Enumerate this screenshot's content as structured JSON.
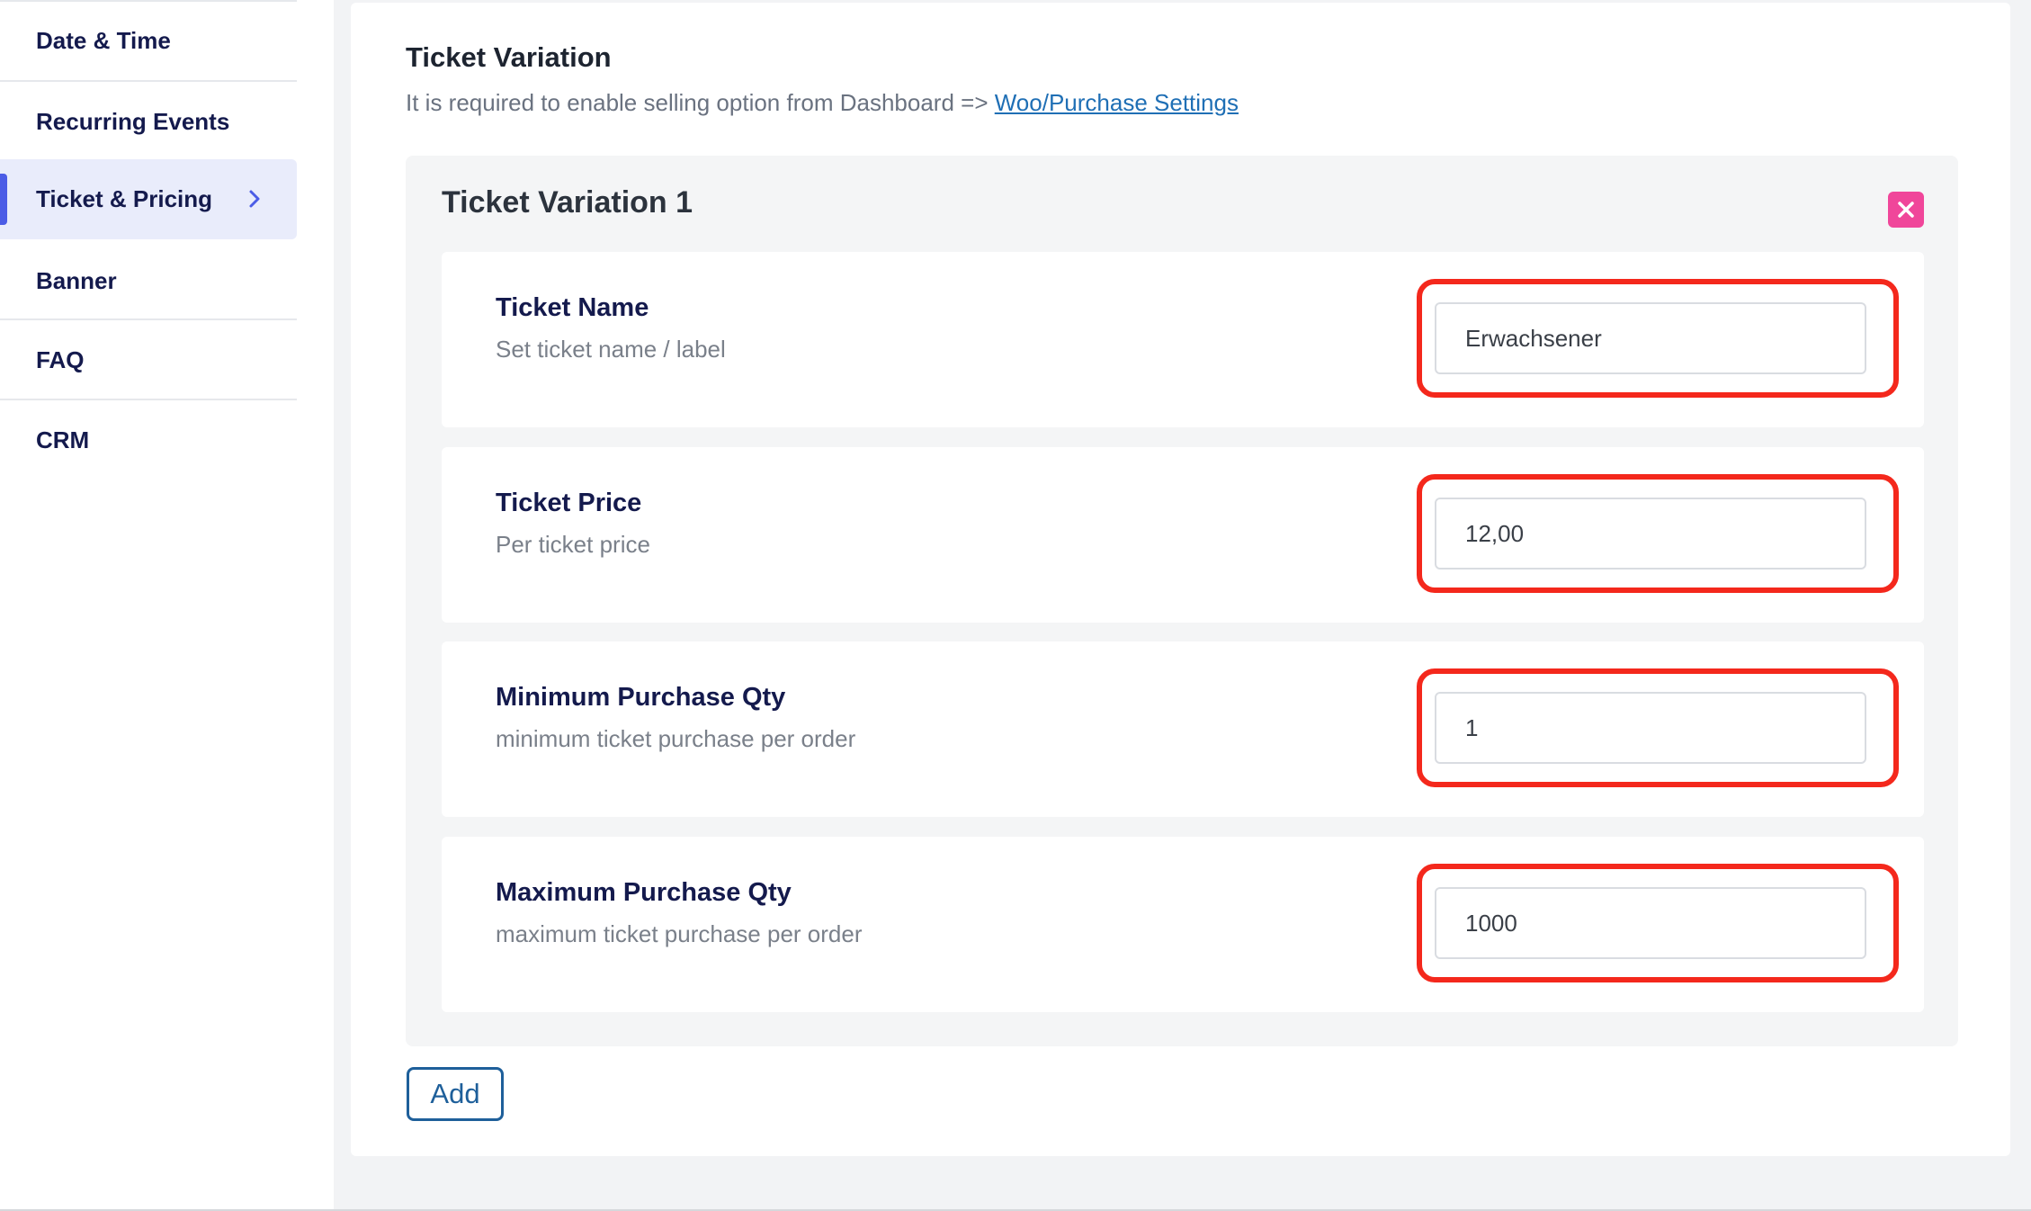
{
  "sidebar": {
    "items": [
      {
        "label": "Date & Time"
      },
      {
        "label": "Recurring Events"
      },
      {
        "label": "Ticket & Pricing"
      },
      {
        "label": "Banner"
      },
      {
        "label": "FAQ"
      },
      {
        "label": "CRM"
      }
    ],
    "active_index": 2
  },
  "section": {
    "title": "Ticket Variation",
    "note": "It is required to enable selling option from Dashboard => ",
    "link_label": "Woo/Purchase Settings"
  },
  "variation": {
    "title": "Ticket Variation 1",
    "fields": [
      {
        "label": "Ticket Name",
        "description": "Set ticket name / label",
        "value": "Erwachsener"
      },
      {
        "label": "Ticket Price",
        "description": "Per ticket price",
        "value": "12,00"
      },
      {
        "label": "Minimum Purchase Qty",
        "description": "minimum ticket purchase per order",
        "value": "1"
      },
      {
        "label": "Maximum Purchase Qty",
        "description": "maximum ticket purchase per order",
        "value": "1000"
      }
    ]
  },
  "add_label": "Add",
  "colors": {
    "accent": "#4b5ce6",
    "highlight": "#f4281c",
    "remove": "#f0469a",
    "link": "#1f6fb5"
  },
  "icons": {
    "active_item": "chevron-right-icon",
    "remove": "close-icon"
  }
}
